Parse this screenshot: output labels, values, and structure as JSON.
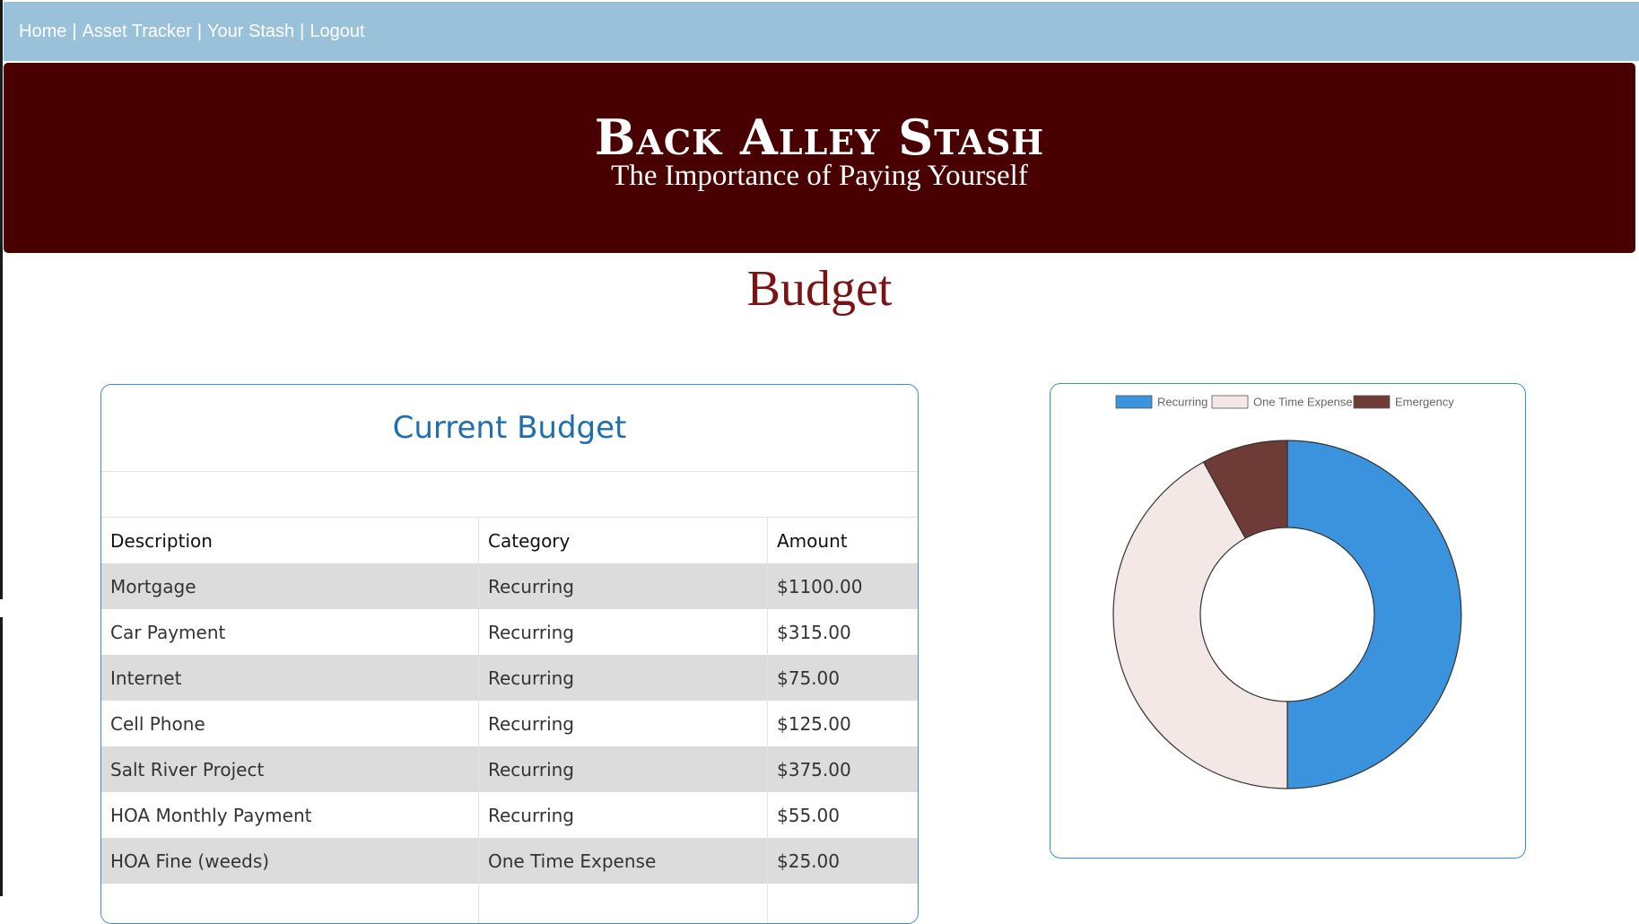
{
  "nav": {
    "home": "Home",
    "asset_tracker": "Asset Tracker",
    "your_stash": "Your Stash",
    "logout": "Logout",
    "separator": "|"
  },
  "banner": {
    "title": "Back Alley Stash",
    "subtitle": "The Importance of Paying Yourself"
  },
  "page_title": "Budget",
  "budget_card": {
    "title": "Current Budget",
    "columns": [
      "Description",
      "Category",
      "Amount"
    ],
    "rows": [
      {
        "description": "Mortgage",
        "category": "Recurring",
        "amount": "$1100.00"
      },
      {
        "description": "Car Payment",
        "category": "Recurring",
        "amount": "$315.00"
      },
      {
        "description": "Internet",
        "category": "Recurring",
        "amount": "$75.00"
      },
      {
        "description": "Cell Phone",
        "category": "Recurring",
        "amount": "$125.00"
      },
      {
        "description": "Salt River Project",
        "category": "Recurring",
        "amount": "$375.00"
      },
      {
        "description": "HOA Monthly Payment",
        "category": "Recurring",
        "amount": "$55.00"
      },
      {
        "description": "HOA Fine (weeds)",
        "category": "One Time Expense",
        "amount": "$25.00"
      }
    ]
  },
  "chart_data": {
    "type": "pie",
    "variant": "doughnut",
    "legend_position": "top",
    "categories": [
      "Recurring",
      "One Time Expense",
      "Emergency"
    ],
    "values": [
      50,
      42,
      8
    ],
    "colors": [
      "#3a93dc",
      "#f3e8e6",
      "#6e3b36"
    ],
    "border_color": "#333333"
  }
}
